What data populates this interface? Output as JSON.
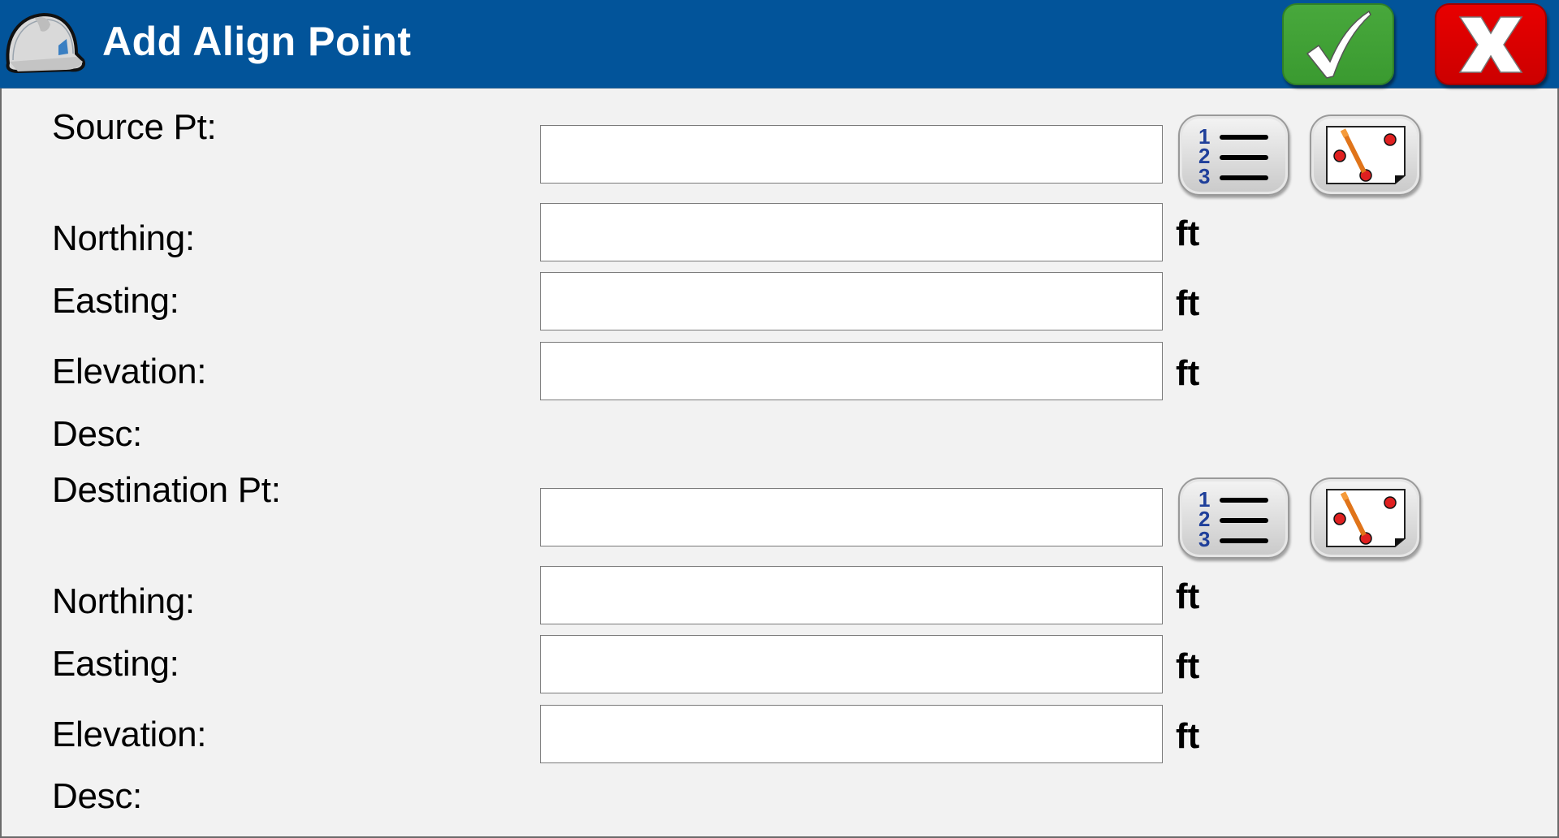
{
  "header": {
    "title": "Add Align Point",
    "app_icon": "hard-hat-icon",
    "ok_icon": "checkmark-icon",
    "cancel_icon": "close-x-icon",
    "colors": {
      "titlebar": "#02549a",
      "ok": "#3f9f35",
      "cancel": "#dd0000"
    }
  },
  "source": {
    "point_label": "Source Pt:",
    "point_value": "",
    "list_button_icon": "numbered-list-icon",
    "map_button_icon": "map-pick-icon",
    "northing_label": "Northing:",
    "northing_value": "",
    "northing_unit": "ft",
    "easting_label": "Easting:",
    "easting_value": "",
    "easting_unit": "ft",
    "elevation_label": "Elevation:",
    "elevation_value": "",
    "elevation_unit": "ft",
    "desc_label": "Desc:"
  },
  "destination": {
    "point_label": "Destination Pt:",
    "point_value": "",
    "list_button_icon": "numbered-list-icon",
    "map_button_icon": "map-pick-icon",
    "northing_label": "Northing:",
    "northing_value": "",
    "northing_unit": "ft",
    "easting_label": "Easting:",
    "easting_value": "",
    "easting_unit": "ft",
    "elevation_label": "Elevation:",
    "elevation_value": "",
    "elevation_unit": "ft",
    "desc_label": "Desc:"
  }
}
